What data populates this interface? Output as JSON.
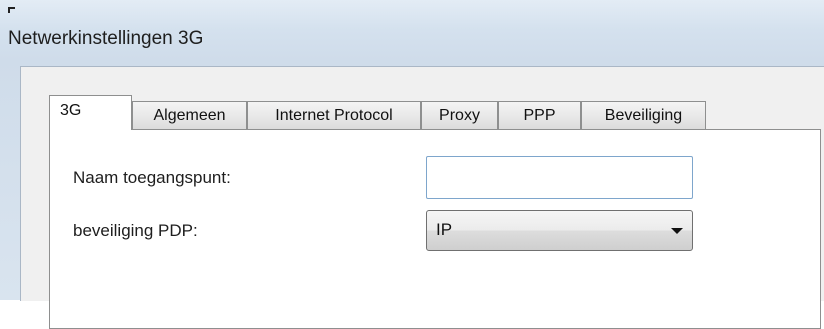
{
  "window": {
    "title": "Netwerkinstellingen 3G"
  },
  "tabs": [
    {
      "label": "3G",
      "active": true
    },
    {
      "label": "Algemeen",
      "active": false
    },
    {
      "label": "Internet Protocol",
      "active": false
    },
    {
      "label": "Proxy",
      "active": false
    },
    {
      "label": "PPP",
      "active": false
    },
    {
      "label": "Beveiliging",
      "active": false
    }
  ],
  "form": {
    "apn_label": "Naam toegangspunt:",
    "apn_value": "",
    "pdp_label": "beveiliging PDP:",
    "pdp_value": "IP"
  },
  "colors": {
    "title_bar": "#d4e1ee",
    "dialog_background": "#f0f0f0",
    "tab_panel_background": "#ffffff",
    "input_border_focus": "#7ea6cc"
  }
}
